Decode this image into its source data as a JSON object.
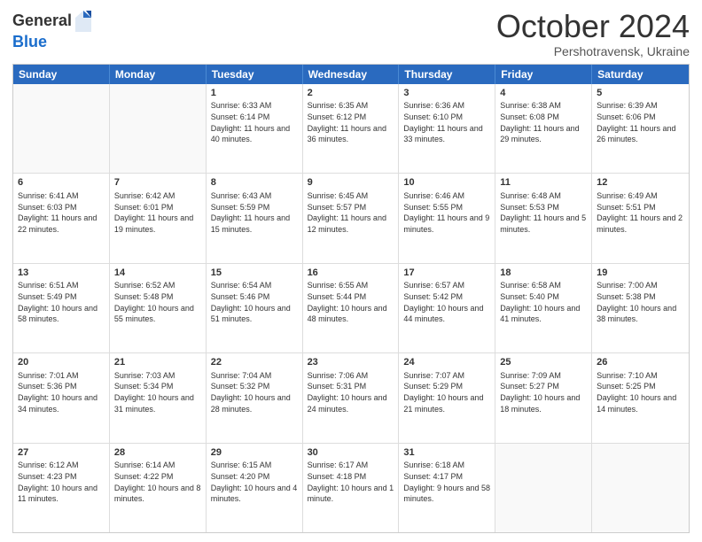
{
  "logo": {
    "general": "General",
    "blue": "Blue"
  },
  "header": {
    "month": "October 2024",
    "location": "Pershotravensk, Ukraine"
  },
  "weekdays": [
    "Sunday",
    "Monday",
    "Tuesday",
    "Wednesday",
    "Thursday",
    "Friday",
    "Saturday"
  ],
  "rows": [
    [
      {
        "day": "",
        "sunrise": "",
        "sunset": "",
        "daylight": ""
      },
      {
        "day": "",
        "sunrise": "",
        "sunset": "",
        "daylight": ""
      },
      {
        "day": "1",
        "sunrise": "Sunrise: 6:33 AM",
        "sunset": "Sunset: 6:14 PM",
        "daylight": "Daylight: 11 hours and 40 minutes."
      },
      {
        "day": "2",
        "sunrise": "Sunrise: 6:35 AM",
        "sunset": "Sunset: 6:12 PM",
        "daylight": "Daylight: 11 hours and 36 minutes."
      },
      {
        "day": "3",
        "sunrise": "Sunrise: 6:36 AM",
        "sunset": "Sunset: 6:10 PM",
        "daylight": "Daylight: 11 hours and 33 minutes."
      },
      {
        "day": "4",
        "sunrise": "Sunrise: 6:38 AM",
        "sunset": "Sunset: 6:08 PM",
        "daylight": "Daylight: 11 hours and 29 minutes."
      },
      {
        "day": "5",
        "sunrise": "Sunrise: 6:39 AM",
        "sunset": "Sunset: 6:06 PM",
        "daylight": "Daylight: 11 hours and 26 minutes."
      }
    ],
    [
      {
        "day": "6",
        "sunrise": "Sunrise: 6:41 AM",
        "sunset": "Sunset: 6:03 PM",
        "daylight": "Daylight: 11 hours and 22 minutes."
      },
      {
        "day": "7",
        "sunrise": "Sunrise: 6:42 AM",
        "sunset": "Sunset: 6:01 PM",
        "daylight": "Daylight: 11 hours and 19 minutes."
      },
      {
        "day": "8",
        "sunrise": "Sunrise: 6:43 AM",
        "sunset": "Sunset: 5:59 PM",
        "daylight": "Daylight: 11 hours and 15 minutes."
      },
      {
        "day": "9",
        "sunrise": "Sunrise: 6:45 AM",
        "sunset": "Sunset: 5:57 PM",
        "daylight": "Daylight: 11 hours and 12 minutes."
      },
      {
        "day": "10",
        "sunrise": "Sunrise: 6:46 AM",
        "sunset": "Sunset: 5:55 PM",
        "daylight": "Daylight: 11 hours and 9 minutes."
      },
      {
        "day": "11",
        "sunrise": "Sunrise: 6:48 AM",
        "sunset": "Sunset: 5:53 PM",
        "daylight": "Daylight: 11 hours and 5 minutes."
      },
      {
        "day": "12",
        "sunrise": "Sunrise: 6:49 AM",
        "sunset": "Sunset: 5:51 PM",
        "daylight": "Daylight: 11 hours and 2 minutes."
      }
    ],
    [
      {
        "day": "13",
        "sunrise": "Sunrise: 6:51 AM",
        "sunset": "Sunset: 5:49 PM",
        "daylight": "Daylight: 10 hours and 58 minutes."
      },
      {
        "day": "14",
        "sunrise": "Sunrise: 6:52 AM",
        "sunset": "Sunset: 5:48 PM",
        "daylight": "Daylight: 10 hours and 55 minutes."
      },
      {
        "day": "15",
        "sunrise": "Sunrise: 6:54 AM",
        "sunset": "Sunset: 5:46 PM",
        "daylight": "Daylight: 10 hours and 51 minutes."
      },
      {
        "day": "16",
        "sunrise": "Sunrise: 6:55 AM",
        "sunset": "Sunset: 5:44 PM",
        "daylight": "Daylight: 10 hours and 48 minutes."
      },
      {
        "day": "17",
        "sunrise": "Sunrise: 6:57 AM",
        "sunset": "Sunset: 5:42 PM",
        "daylight": "Daylight: 10 hours and 44 minutes."
      },
      {
        "day": "18",
        "sunrise": "Sunrise: 6:58 AM",
        "sunset": "Sunset: 5:40 PM",
        "daylight": "Daylight: 10 hours and 41 minutes."
      },
      {
        "day": "19",
        "sunrise": "Sunrise: 7:00 AM",
        "sunset": "Sunset: 5:38 PM",
        "daylight": "Daylight: 10 hours and 38 minutes."
      }
    ],
    [
      {
        "day": "20",
        "sunrise": "Sunrise: 7:01 AM",
        "sunset": "Sunset: 5:36 PM",
        "daylight": "Daylight: 10 hours and 34 minutes."
      },
      {
        "day": "21",
        "sunrise": "Sunrise: 7:03 AM",
        "sunset": "Sunset: 5:34 PM",
        "daylight": "Daylight: 10 hours and 31 minutes."
      },
      {
        "day": "22",
        "sunrise": "Sunrise: 7:04 AM",
        "sunset": "Sunset: 5:32 PM",
        "daylight": "Daylight: 10 hours and 28 minutes."
      },
      {
        "day": "23",
        "sunrise": "Sunrise: 7:06 AM",
        "sunset": "Sunset: 5:31 PM",
        "daylight": "Daylight: 10 hours and 24 minutes."
      },
      {
        "day": "24",
        "sunrise": "Sunrise: 7:07 AM",
        "sunset": "Sunset: 5:29 PM",
        "daylight": "Daylight: 10 hours and 21 minutes."
      },
      {
        "day": "25",
        "sunrise": "Sunrise: 7:09 AM",
        "sunset": "Sunset: 5:27 PM",
        "daylight": "Daylight: 10 hours and 18 minutes."
      },
      {
        "day": "26",
        "sunrise": "Sunrise: 7:10 AM",
        "sunset": "Sunset: 5:25 PM",
        "daylight": "Daylight: 10 hours and 14 minutes."
      }
    ],
    [
      {
        "day": "27",
        "sunrise": "Sunrise: 6:12 AM",
        "sunset": "Sunset: 4:23 PM",
        "daylight": "Daylight: 10 hours and 11 minutes."
      },
      {
        "day": "28",
        "sunrise": "Sunrise: 6:14 AM",
        "sunset": "Sunset: 4:22 PM",
        "daylight": "Daylight: 10 hours and 8 minutes."
      },
      {
        "day": "29",
        "sunrise": "Sunrise: 6:15 AM",
        "sunset": "Sunset: 4:20 PM",
        "daylight": "Daylight: 10 hours and 4 minutes."
      },
      {
        "day": "30",
        "sunrise": "Sunrise: 6:17 AM",
        "sunset": "Sunset: 4:18 PM",
        "daylight": "Daylight: 10 hours and 1 minute."
      },
      {
        "day": "31",
        "sunrise": "Sunrise: 6:18 AM",
        "sunset": "Sunset: 4:17 PM",
        "daylight": "Daylight: 9 hours and 58 minutes."
      },
      {
        "day": "",
        "sunrise": "",
        "sunset": "",
        "daylight": ""
      },
      {
        "day": "",
        "sunrise": "",
        "sunset": "",
        "daylight": ""
      }
    ]
  ]
}
